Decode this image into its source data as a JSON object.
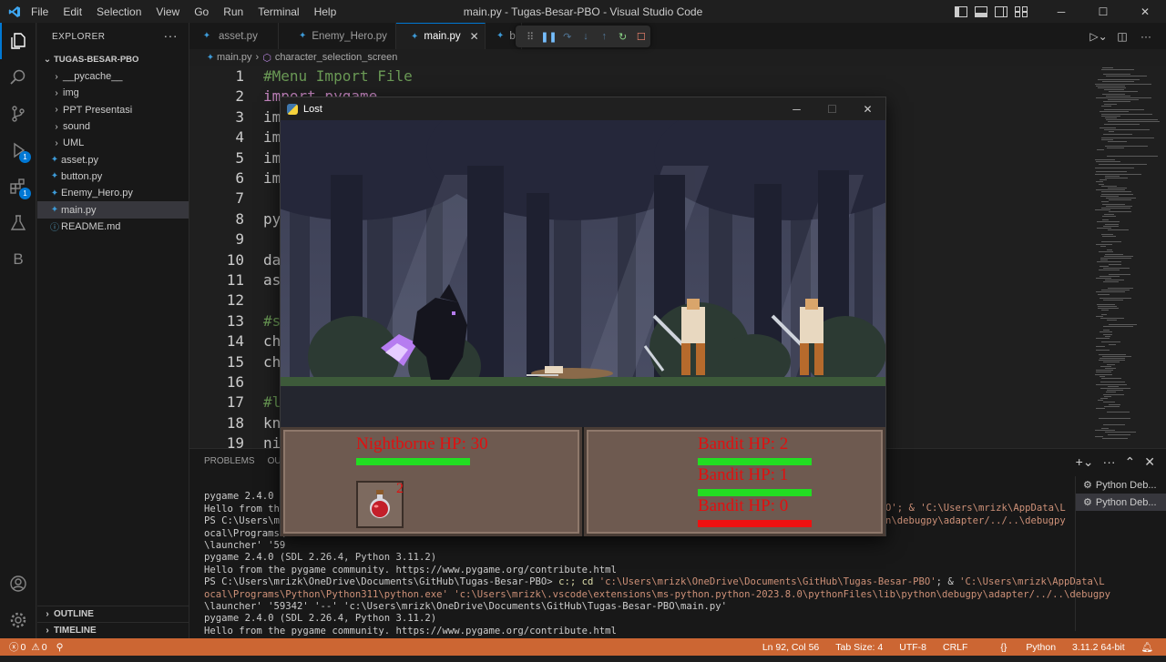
{
  "titlebar": {
    "menu": [
      "File",
      "Edit",
      "Selection",
      "View",
      "Go",
      "Run",
      "Terminal",
      "Help"
    ],
    "title": "main.py - Tugas-Besar-PBO - Visual Studio Code"
  },
  "activitybar": {
    "badges": {
      "run": "1",
      "extensions": "1"
    },
    "b_label": "B"
  },
  "sidebar": {
    "header": "EXPLORER",
    "root": "TUGAS-BESAR-PBO",
    "items": [
      {
        "label": "__pycache__",
        "type": "folder"
      },
      {
        "label": "img",
        "type": "folder"
      },
      {
        "label": "PPT Presentasi",
        "type": "folder"
      },
      {
        "label": "sound",
        "type": "folder"
      },
      {
        "label": "UML",
        "type": "folder"
      },
      {
        "label": "asset.py",
        "type": "py"
      },
      {
        "label": "button.py",
        "type": "py"
      },
      {
        "label": "Enemy_Hero.py",
        "type": "py"
      },
      {
        "label": "main.py",
        "type": "py"
      },
      {
        "label": "README.md",
        "type": "md"
      }
    ],
    "outline": "OUTLINE",
    "timeline": "TIMELINE"
  },
  "tabs": [
    {
      "label": "asset.py"
    },
    {
      "label": "Enemy_Hero.py"
    },
    {
      "label": "main.py"
    },
    {
      "label": "b"
    }
  ],
  "breadcrumb": {
    "file": "main.py",
    "symbol": "character_selection_screen"
  },
  "code": {
    "lines": [
      {
        "n": "1",
        "text": "#Menu Import File"
      },
      {
        "n": "2",
        "text": "import pygame"
      },
      {
        "n": "3",
        "text": "im"
      },
      {
        "n": "4",
        "text": "im"
      },
      {
        "n": "5",
        "text": "im"
      },
      {
        "n": "6",
        "text": "im"
      },
      {
        "n": "7",
        "text": ""
      },
      {
        "n": "8",
        "text": "py"
      },
      {
        "n": "9",
        "text": ""
      },
      {
        "n": "10",
        "text": "da"
      },
      {
        "n": "11",
        "text": "as"
      },
      {
        "n": "12",
        "text": ""
      },
      {
        "n": "13",
        "text": "#s"
      },
      {
        "n": "14",
        "text": "ch"
      },
      {
        "n": "15",
        "text": "ch"
      },
      {
        "n": "16",
        "text": ""
      },
      {
        "n": "17",
        "text": "#l"
      },
      {
        "n": "18",
        "text": "kn"
      },
      {
        "n": "19",
        "text": "ni"
      }
    ]
  },
  "panel": {
    "tabs": [
      "PROBLEMS",
      "OUT"
    ],
    "terminal_lines": [
      "pygame 2.4.0 (",
      "Hello from the",
      "PS C:\\Users\\mr",
      "ocal\\Programs\\",
      "\\launcher' '59",
      "pygame 2.4.0 (SDL 2.26.4, Python 3.11.2)",
      "Hello from the pygame community. https://www.pygame.org/contribute.html"
    ],
    "terminal_right_1": "O'; & 'C:\\Users\\mrizk\\AppData\\L",
    "terminal_right_2": "n\\debugpy\\adapter/../..\\debugpy",
    "ps_prompt": "PS C:\\Users\\mrizk\\OneDrive\\Documents\\GitHub\\Tugas-Besar-PBO>",
    "ps_cmd": " c:; cd ",
    "ps_path": "'c:\\Users\\mrizk\\OneDrive\\Documents\\GitHub\\Tugas-Besar-PBO'",
    "ps_rest": "; & ",
    "ps_appdata": "'C:\\Users\\mrizk\\AppData\\L",
    "line2": "ocal\\Programs\\Python\\Python311\\python.exe' 'c:\\Users\\mrizk\\.vscode\\extensions\\ms-python.python-2023.8.0\\pythonFiles\\lib\\python\\debugpy\\adapter/../..\\debugpy",
    "line3": "\\launcher' '59342' '--' 'c:\\Users\\mrizk\\OneDrive\\Documents\\GitHub\\Tugas-Besar-PBO\\main.py'",
    "line4": "pygame 2.4.0 (SDL 2.26.4, Python 3.11.2)",
    "line5": "Hello from the pygame community. https://www.pygame.org/contribute.html",
    "terminals": [
      "Python Deb...",
      "Python Deb..."
    ]
  },
  "statusbar": {
    "errors": "0",
    "warnings": "0",
    "position": "Ln 92, Col 56",
    "tab_size": "Tab Size: 4",
    "encoding": "UTF-8",
    "eol": "CRLF",
    "language": "Python",
    "interpreter": "3.11.2 64-bit"
  },
  "game": {
    "title": "Lost",
    "player_hp": "Nightborne HP: 30",
    "player_hp_fraction": 1.0,
    "enemies": [
      {
        "label": "Bandit HP: 2",
        "hp_fraction": 1.0
      },
      {
        "label": "Bandit HP: 1",
        "hp_fraction": 1.0
      },
      {
        "label": "Bandit HP: 0",
        "hp_fraction": 0.0
      }
    ],
    "potion_count": "2",
    "colors": {
      "hp_green": "#22dd22",
      "hp_red": "#ee1111",
      "hp_text": "#e01010",
      "panel": "#6e5a50"
    }
  },
  "colors": {
    "accent": "#0078d4",
    "statusbar": "#cc6633"
  }
}
